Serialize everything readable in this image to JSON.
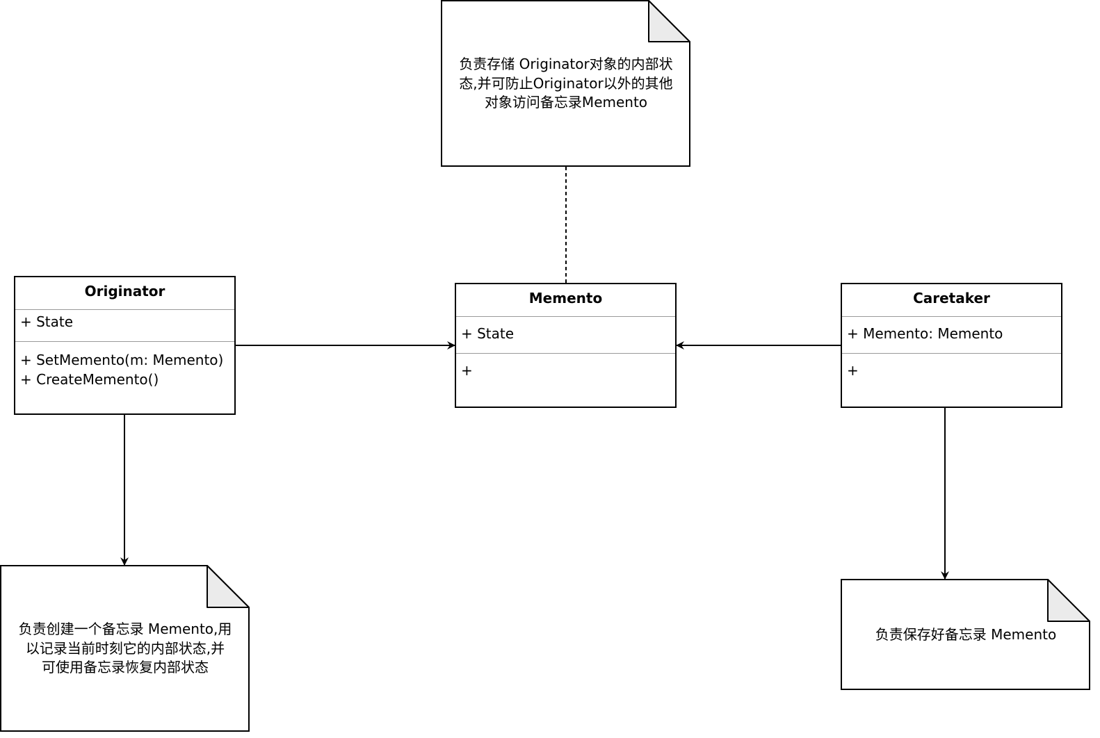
{
  "classes": {
    "originator": {
      "name": "Originator",
      "attributes": [
        "+ State"
      ],
      "methods": [
        "+ SetMemento(m: Memento)",
        "+ CreateMemento()"
      ]
    },
    "memento": {
      "name": "Memento",
      "attributes": [
        "+ State"
      ],
      "methods": [
        "+"
      ]
    },
    "caretaker": {
      "name": "Caretaker",
      "attributes": [
        "+ Memento: Memento"
      ],
      "methods": [
        "+"
      ]
    }
  },
  "notes": {
    "memento_note": {
      "lines": [
        "负责存储 Originator对象的内部状",
        "态,并可防止Originator以外的其他",
        "对象访问备忘录Memento"
      ]
    },
    "originator_note": {
      "lines": [
        "负责创建一个备忘录 Memento,用",
        "以记录当前时刻它的内部状态,并",
        "可使用备忘录恢复内部状态"
      ]
    },
    "caretaker_note": {
      "lines": [
        "负责保存好备忘录 Memento"
      ]
    }
  },
  "colors": {
    "stroke": "#000000",
    "note_fold": "#ebebeb",
    "divider": "#999999"
  }
}
